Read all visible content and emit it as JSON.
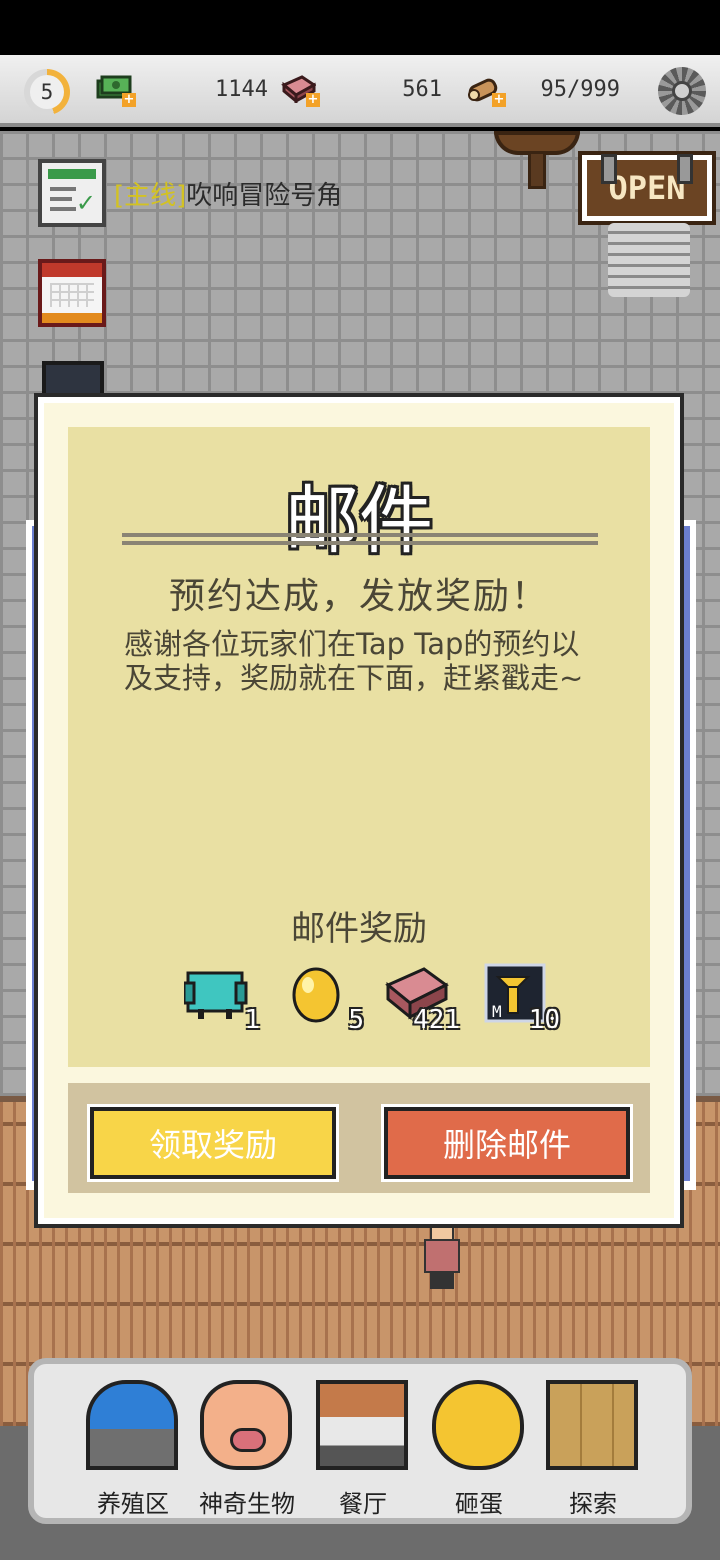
{
  "top_bar": {
    "level": "5",
    "level_progress": 0.45,
    "cash_value": "1144",
    "meat_value": "561",
    "wood_value": "95/999"
  },
  "quest": {
    "tag": "[主线]",
    "text": "吹响冒险号角"
  },
  "sign": {
    "open_label": "OPEN"
  },
  "mail": {
    "title": "邮件",
    "subject": "预约达成，发放奖励！",
    "body": "感谢各位玩家们在Tap Tap的预约以及支持，奖励就在下面，赶紧戳走~",
    "reward_title": "邮件奖励",
    "rewards": [
      {
        "icon": "taptap-icon",
        "count": "1"
      },
      {
        "icon": "golden-egg-icon",
        "count": "5"
      },
      {
        "icon": "meat-icon",
        "count": "421"
      },
      {
        "icon": "speedup-icon",
        "count": "10",
        "label": "M"
      }
    ],
    "claim_label": "领取奖励",
    "delete_label": "删除邮件"
  },
  "nav": {
    "items": [
      {
        "label": "养殖区",
        "icon": "farm-building-icon"
      },
      {
        "label": "神奇生物",
        "icon": "pig-creature-icon"
      },
      {
        "label": "餐厅",
        "icon": "restaurant-icon"
      },
      {
        "label": "砸蛋",
        "icon": "egg-icon"
      },
      {
        "label": "探索",
        "icon": "map-icon"
      }
    ]
  },
  "colors": {
    "quest_tag": "#d3c222",
    "claim_button": "#f8d548",
    "delete_button": "#e06b4a",
    "dialog_inner": "#e9e0a3"
  }
}
